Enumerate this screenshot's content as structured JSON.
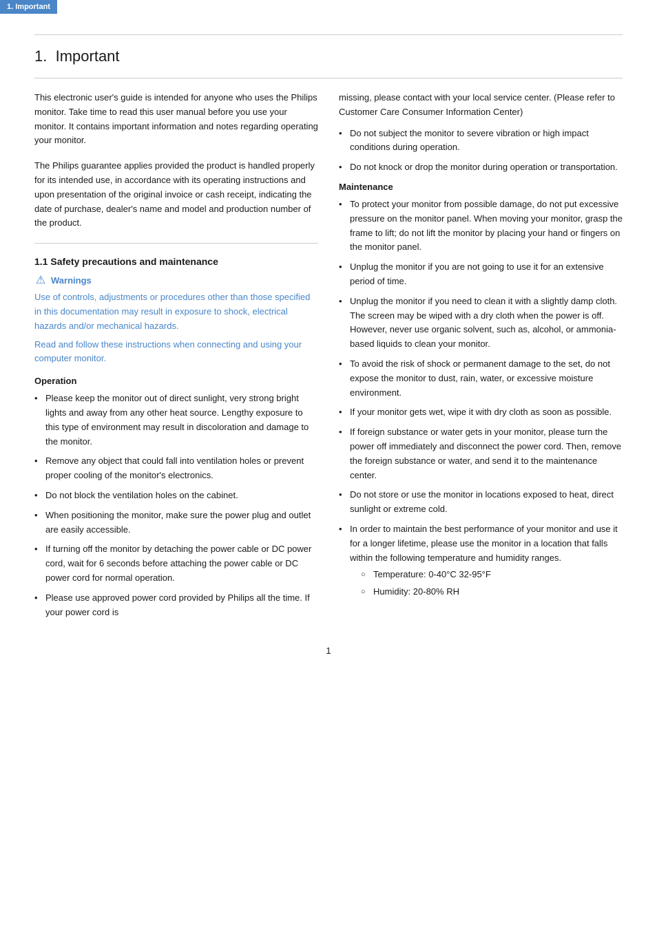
{
  "tab": {
    "label": "1. Important"
  },
  "section": {
    "number": "1.",
    "title": "Important"
  },
  "intro": {
    "paragraph1": "This electronic user's guide is intended for anyone who uses the Philips monitor. Take time to read this user manual before you use your monitor. It contains important information and notes regarding operating your monitor.",
    "paragraph2": "The Philips guarantee applies provided the product is handled properly for its intended use, in accordance with its operating instructions and upon presentation of the original invoice or cash receipt, indicating the date of purchase, dealer's name and model and production number of the product."
  },
  "subsection_title": "1.1 Safety precautions and maintenance",
  "warnings": {
    "label": "Warnings",
    "text1": "Use of controls, adjustments or procedures other than those specified in this documentation may result in exposure to shock, electrical hazards and/or mechanical hazards.",
    "text2": "Read and follow these instructions when connecting and using your computer monitor."
  },
  "operation": {
    "title": "Operation",
    "items": [
      "Please keep the monitor out of direct sunlight, very strong bright lights and away from any other heat source. Lengthy exposure to this type of environment may result in discoloration and damage to the monitor.",
      "Remove any object that could fall into ventilation holes or prevent proper cooling of the monitor's electronics.",
      "Do not block the ventilation holes on the cabinet.",
      "When positioning the monitor, make sure the power plug and outlet are easily accessible.",
      "If turning off the monitor by detaching the power cable or DC power cord, wait for 6 seconds before attaching the power cable or DC power cord for normal operation.",
      "Please use approved power cord provided by Philips all the time. If your power cord is"
    ]
  },
  "right_col": {
    "power_cord_continued": "missing, please contact with your local service center. (Please refer to Customer Care Consumer Information Center)",
    "items_after_power": [
      "Do not subject the monitor to severe vibration or high impact conditions during operation.",
      "Do not knock or drop the monitor during operation or transportation."
    ],
    "maintenance": {
      "title": "Maintenance",
      "items": [
        "To protect your monitor from possible damage, do not put excessive pressure on the monitor panel. When moving your monitor, grasp the frame to lift; do not lift the monitor by placing your hand or fingers on the monitor panel.",
        "Unplug the monitor if you are not going to use it for an extensive period of time.",
        "Unplug the monitor if you need to clean it with a slightly damp cloth. The screen may be wiped with a dry cloth when the power is off. However, never use organic solvent, such as, alcohol, or ammonia-based liquids to clean your monitor.",
        "To avoid the risk of shock or permanent damage to the set, do not expose the monitor to dust, rain, water, or excessive moisture environment.",
        "If your monitor gets wet, wipe it with dry cloth as soon as possible.",
        "If foreign substance or water gets in your monitor, please turn the power off immediately and disconnect the power cord. Then, remove the foreign substance or water, and send it to the maintenance center.",
        "Do not store or use the monitor in locations exposed to heat, direct sunlight or extreme cold.",
        "In order to maintain the best performance of your monitor and use it for a longer lifetime, please use the monitor in a location that falls within the following temperature and humidity ranges."
      ],
      "sub_items": [
        "Temperature: 0-40°C  32-95°F",
        "Humidity: 20-80% RH"
      ]
    }
  },
  "page_number": "1"
}
